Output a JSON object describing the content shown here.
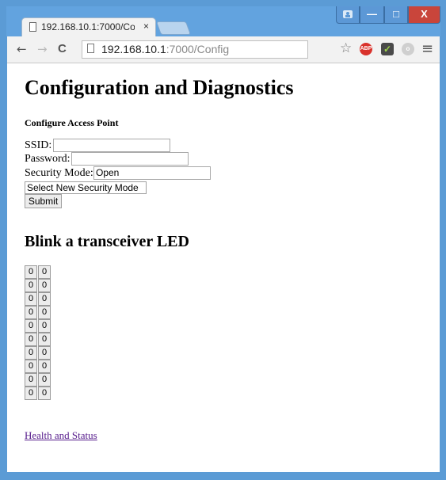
{
  "browser": {
    "tab_title": "192.168.10.1:7000/Co",
    "tab_close": "×",
    "address_host": "192.168.10.1",
    "address_rest": ":7000/Config",
    "nav_back": "←",
    "nav_forward": "→",
    "nav_reload": "C",
    "star_icon": "☆",
    "abp_label": "ABP",
    "menu_icon": "≡",
    "win_minimize": "—",
    "win_maximize": "□",
    "win_close": "X"
  },
  "page": {
    "title": "Configuration and Diagnostics",
    "ap_section_title": "Configure Access Point",
    "ssid_label": "SSID:",
    "ssid_value": "",
    "password_label": "Password:",
    "password_value": "",
    "security_label": "Security Mode:",
    "security_value": "Open",
    "security_select": "Select New Security Mode",
    "submit_label": "Submit",
    "blink_title": "Blink a transceiver LED",
    "led_buttons": [
      [
        "0",
        "0"
      ],
      [
        "0",
        "0"
      ],
      [
        "0",
        "0"
      ],
      [
        "0",
        "0"
      ],
      [
        "0",
        "0"
      ],
      [
        "0",
        "0"
      ],
      [
        "0",
        "0"
      ],
      [
        "0",
        "0"
      ],
      [
        "0",
        "0"
      ],
      [
        "0",
        "0"
      ]
    ],
    "health_link": "Health and Status"
  }
}
